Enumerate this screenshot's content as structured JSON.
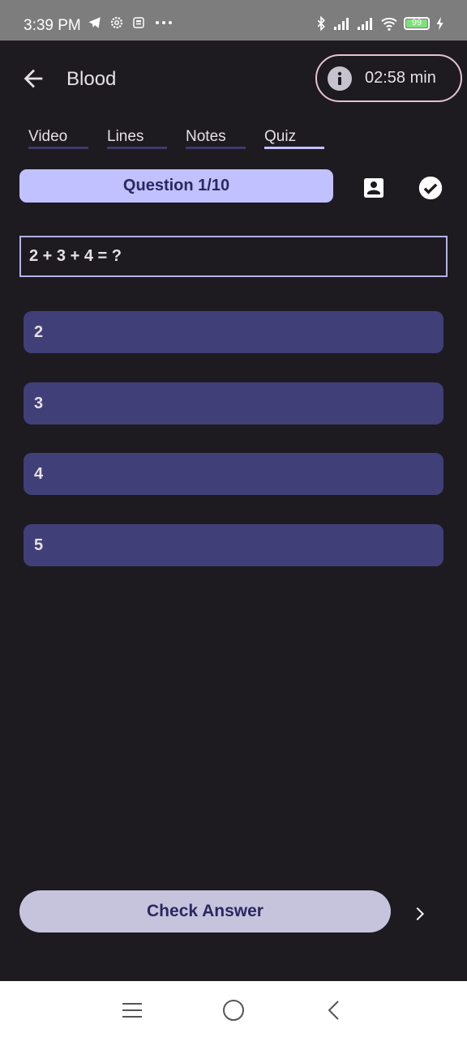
{
  "status_bar": {
    "time": "3:39 PM",
    "battery": "99",
    "battery_level": 0.99,
    "icons_left": [
      "telegram-icon",
      "settings-icon",
      "news-icon",
      "more-dots-icon"
    ],
    "icons_right": [
      "bluetooth-icon",
      "signal-icon",
      "signal-icon",
      "wifi-icon",
      "battery-icon",
      "charging-icon"
    ]
  },
  "app_bar": {
    "title": "Blood",
    "back_icon": "arrow-back-icon",
    "timer": "02:58 min",
    "timer_icon": "info-icon"
  },
  "tabs": [
    {
      "label": "Video",
      "active": false
    },
    {
      "label": "Lines",
      "active": false
    },
    {
      "label": "Notes",
      "active": false
    },
    {
      "label": "Quiz",
      "active": true
    }
  ],
  "quiz": {
    "counter": "Question 1/10",
    "question": "2 + 3 + 4 = ?",
    "options": [
      "2",
      "3",
      "4",
      "5"
    ],
    "check_label": "Check Answer",
    "icons": [
      "account-box-icon",
      "check-circle-icon",
      "chevron-right-icon"
    ]
  },
  "colors": {
    "background": "#1d1b20",
    "accent": "#c2c1ff",
    "option_bg": "#413f78",
    "chip_border": "#e8c1cf",
    "button_bg": "#c6c4dd"
  },
  "nav_bar": {
    "icons": [
      "menu-icon",
      "home-icon",
      "back-icon"
    ]
  }
}
